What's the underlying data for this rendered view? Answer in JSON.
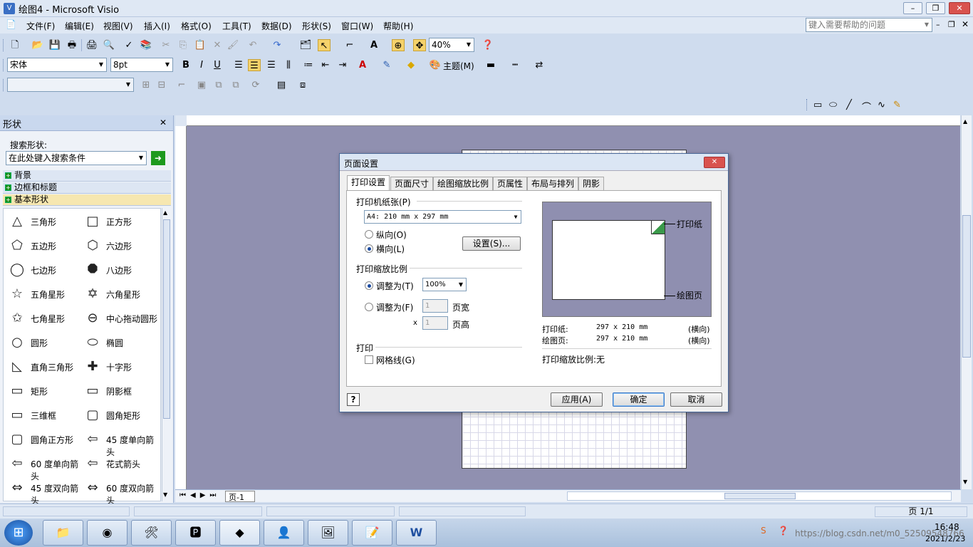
{
  "window": {
    "title": "绘图4 - Microsoft Visio",
    "help_placeholder": "键入需要帮助的问题"
  },
  "menu": [
    "文件(F)",
    "编辑(E)",
    "视图(V)",
    "插入(I)",
    "格式(O)",
    "工具(T)",
    "数据(D)",
    "形状(S)",
    "窗口(W)",
    "帮助(H)"
  ],
  "toolbar": {
    "zoom": "40%",
    "font": "宋体",
    "font_size": "8pt",
    "theme": "主题(M)"
  },
  "shapes_pane": {
    "title": "形状",
    "search_label": "搜索形状:",
    "search_placeholder": "在此处键入搜索条件",
    "categories": [
      "背景",
      "边框和标题",
      "基本形状"
    ],
    "items": [
      {
        "label": "三角形",
        "icon": "triangle-icon"
      },
      {
        "label": "正方形",
        "icon": "square-icon"
      },
      {
        "label": "五边形",
        "icon": "pentagon-icon"
      },
      {
        "label": "六边形",
        "icon": "hexagon-icon"
      },
      {
        "label": "七边形",
        "icon": "heptagon-icon"
      },
      {
        "label": "八边形",
        "icon": "octagon-icon"
      },
      {
        "label": "五角星形",
        "icon": "star5-icon"
      },
      {
        "label": "六角星形",
        "icon": "star6-icon"
      },
      {
        "label": "七角星形",
        "icon": "star7-icon"
      },
      {
        "label": "中心拖动圆形",
        "icon": "center-circle-icon"
      },
      {
        "label": "圆形",
        "icon": "circle-icon"
      },
      {
        "label": "椭圆",
        "icon": "ellipse-icon"
      },
      {
        "label": "直角三角形",
        "icon": "right-triangle-icon"
      },
      {
        "label": "十字形",
        "icon": "cross-icon"
      },
      {
        "label": "矩形",
        "icon": "rectangle-icon"
      },
      {
        "label": "阴影框",
        "icon": "shadow-box-icon"
      },
      {
        "label": "三维框",
        "icon": "3d-box-icon"
      },
      {
        "label": "圆角矩形",
        "icon": "rounded-rect-icon"
      },
      {
        "label": "圆角正方形",
        "icon": "rounded-square-icon"
      },
      {
        "label": "45 度单向箭头",
        "icon": "arrow-left-icon"
      },
      {
        "label": "60 度单向箭头",
        "icon": "arrow-left-icon"
      },
      {
        "label": "花式箭头",
        "icon": "fancy-arrow-icon"
      },
      {
        "label": "45 度双向箭头",
        "icon": "double-arrow-icon"
      },
      {
        "label": "60 度双向箭头",
        "icon": "double-arrow-icon"
      }
    ]
  },
  "page_tab": "页-1",
  "status": {
    "page": "页 1/1"
  },
  "dialog": {
    "title": "页面设置",
    "tabs": [
      "打印设置",
      "页面尺寸",
      "绘图缩放比例",
      "页属性",
      "布局与排列",
      "阴影"
    ],
    "printer_paper_label": "打印机纸张(P)",
    "paper": "A4:  210 mm x 297 mm",
    "portrait": "纵向(O)",
    "landscape": "横向(L)",
    "setup_button": "设置(S)...",
    "scale_label": "打印缩放比例",
    "fit_to": "调整为(T)",
    "fit_value": "100%",
    "fit_pages": "调整为(F)",
    "pages_wide_val": "1",
    "pages_wide": "页宽",
    "x": "x",
    "pages_high_val": "1",
    "pages_high": "页高",
    "print_label": "打印",
    "gridlines": "网格线(G)",
    "preview_paper": "打印纸",
    "preview_drawing": "绘图页",
    "info": [
      {
        "k": "打印纸:",
        "v": "297 x 210 mm",
        "o": "(横向)"
      },
      {
        "k": "绘图页:",
        "v": "297 x 210 mm",
        "o": "(横向)"
      }
    ],
    "scale_info": "打印缩放比例:无",
    "apply": "应用(A)",
    "ok": "确定",
    "cancel": "取消"
  },
  "taskbar": {
    "time": "16:48",
    "date": "2021/2/23",
    "watermark": "https://blog.csdn.net/m0_52509548766"
  }
}
